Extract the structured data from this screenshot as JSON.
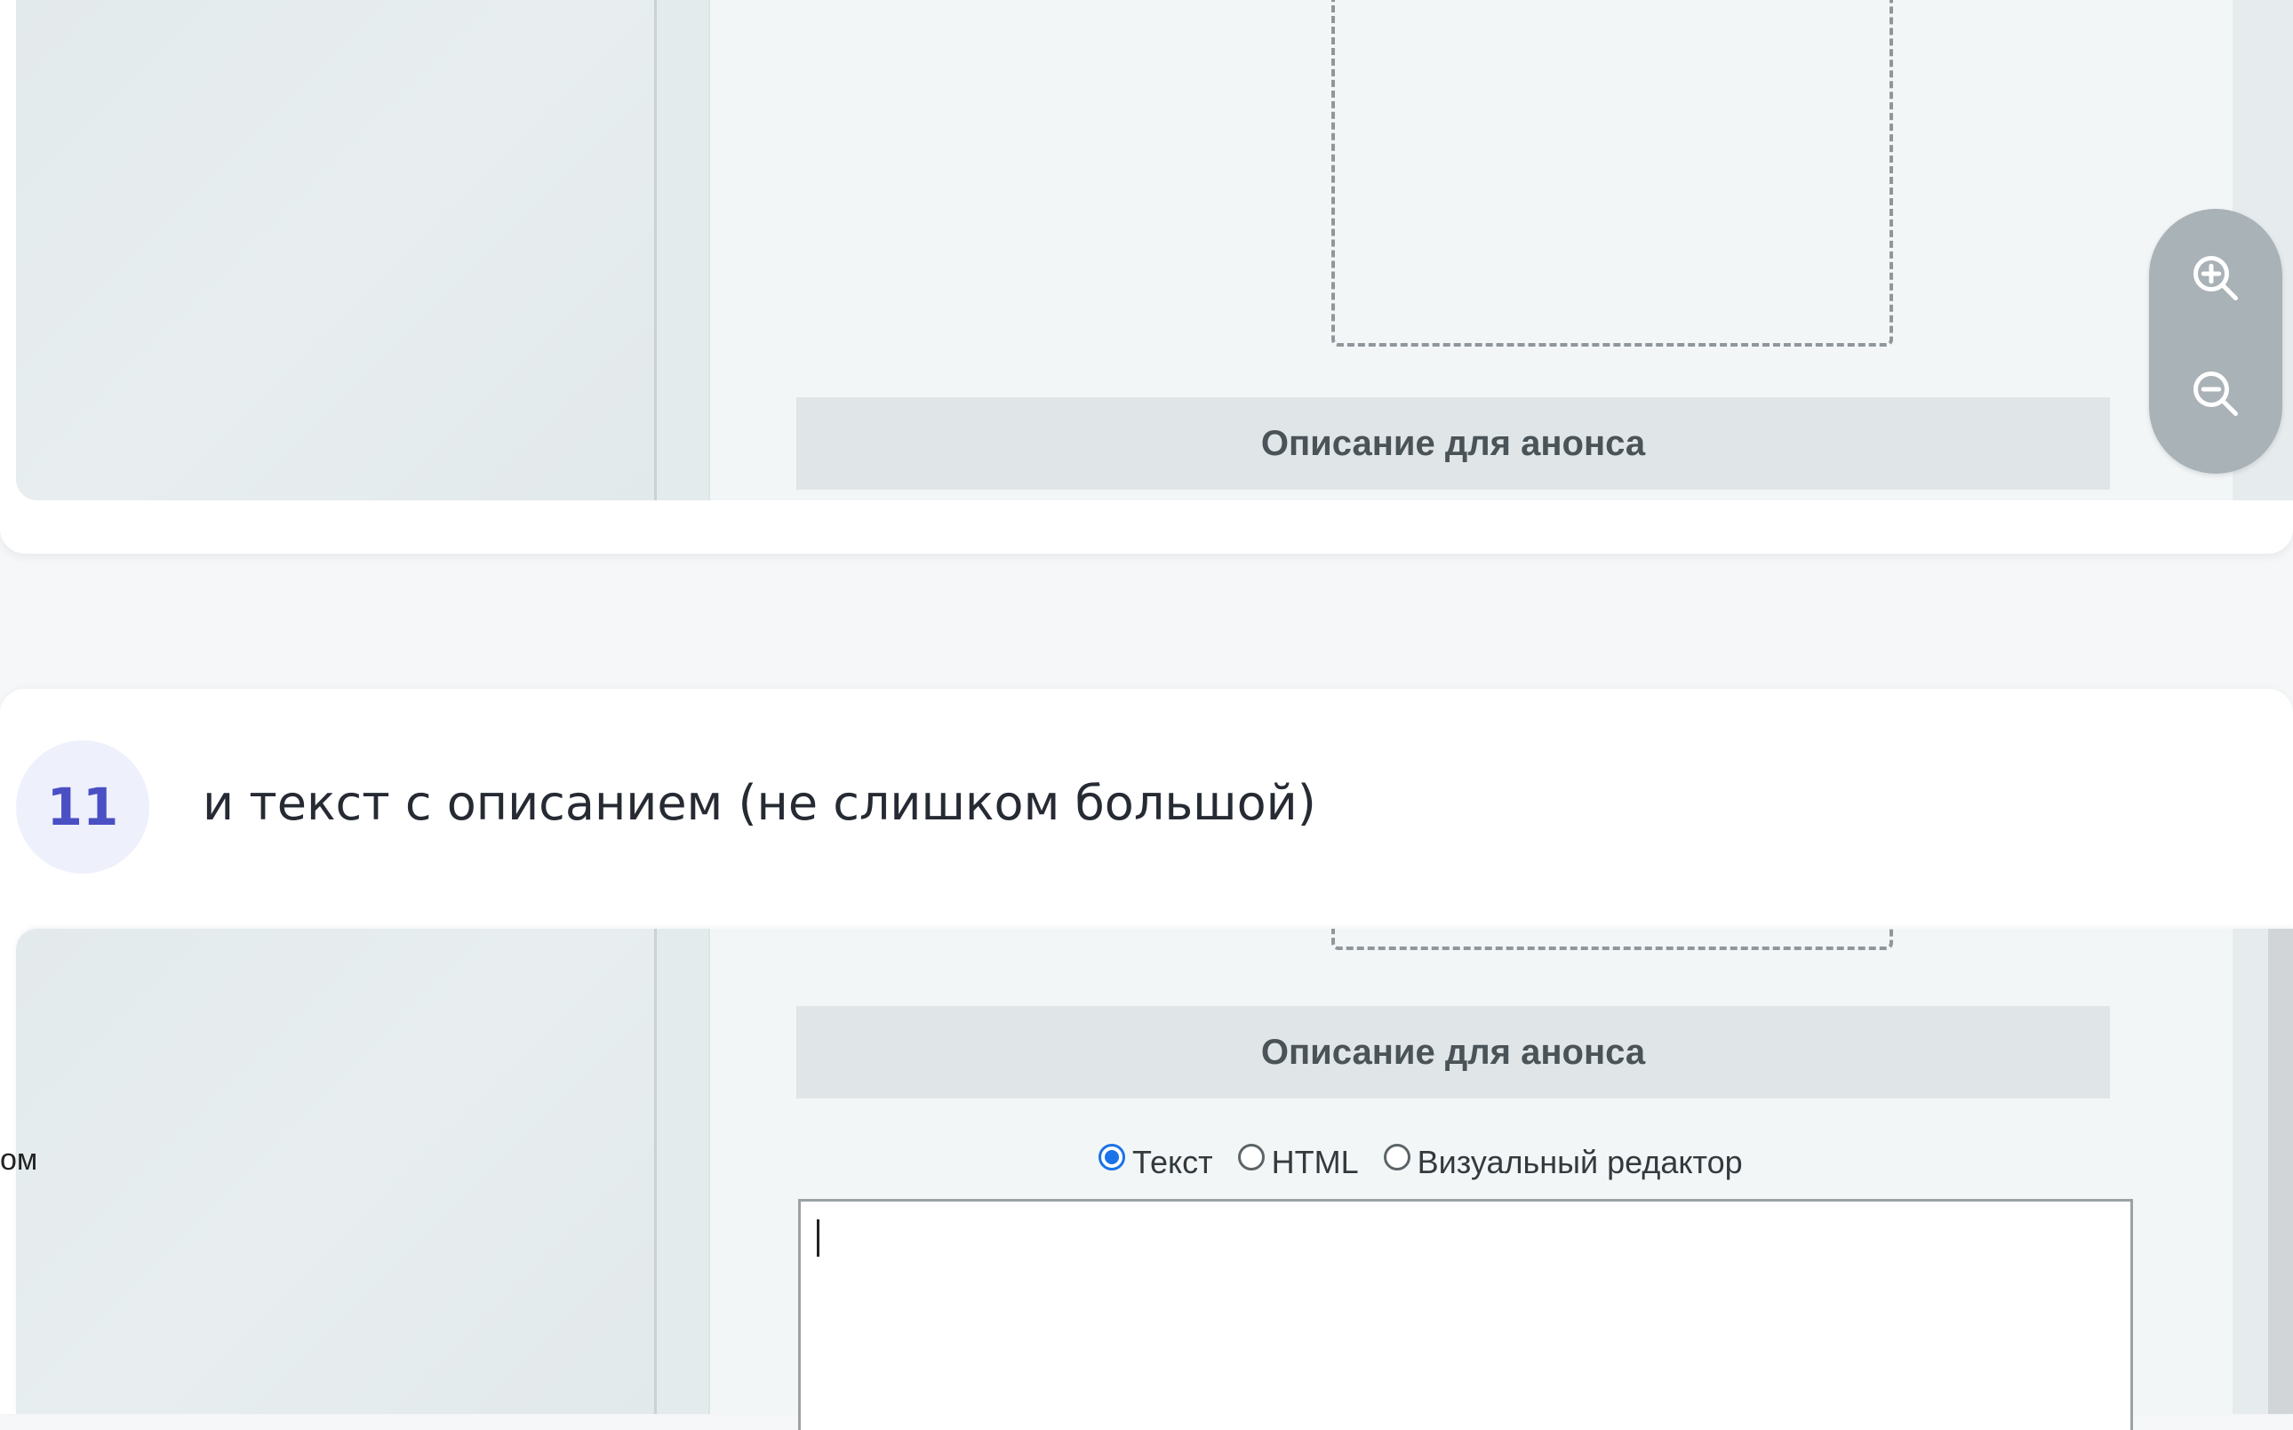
{
  "shot1": {
    "section_title": "Описание для анонса",
    "zoom": {
      "zoom_in_icon": "zoom-in-icon",
      "zoom_out_icon": "zoom-out-icon"
    }
  },
  "step": {
    "number": "11",
    "text": "и текст с описанием (не слишком большой)"
  },
  "shot2": {
    "section_title": "Описание для анонса",
    "cut_label": "ом",
    "editor_modes": [
      {
        "label": "Текст",
        "checked": true
      },
      {
        "label": "HTML",
        "checked": false
      },
      {
        "label": "Визуальный редактор",
        "checked": false
      }
    ],
    "editor_value": ""
  }
}
